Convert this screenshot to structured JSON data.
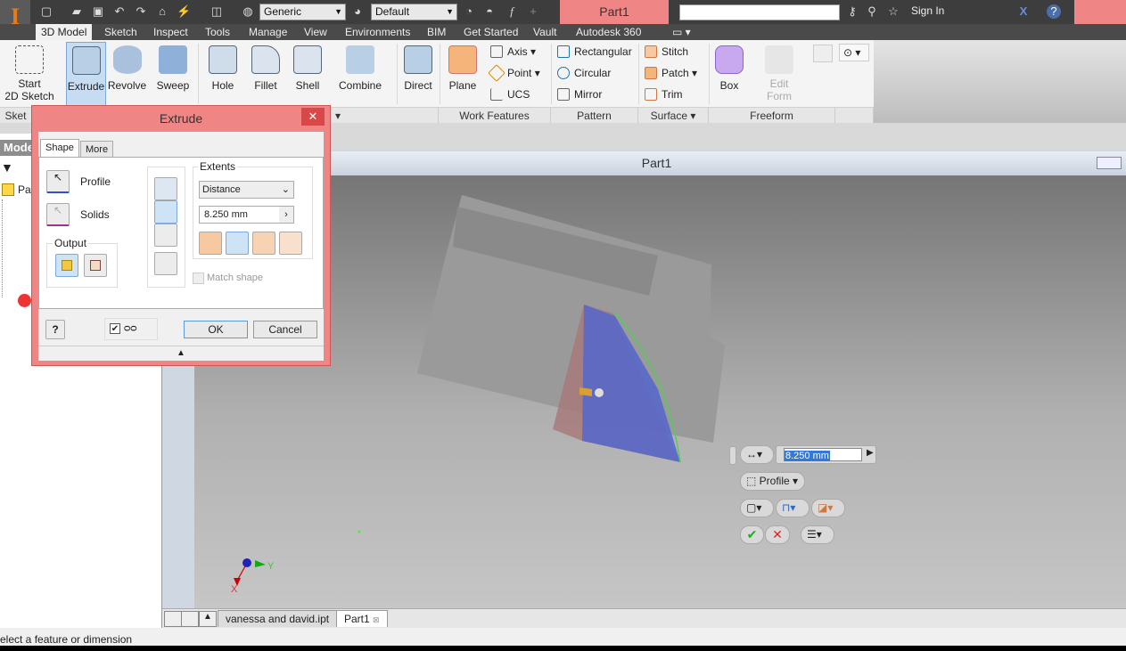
{
  "app": {
    "logo": "I",
    "document_title": "Part1",
    "material": "Generic",
    "appearance": "Default",
    "search_placeholder": "",
    "sign_in": "Sign In"
  },
  "ribbon_tabs": [
    "3D Model",
    "Sketch",
    "Inspect",
    "Tools",
    "Manage",
    "View",
    "Environments",
    "BIM",
    "Get Started",
    "Vault",
    "Autodesk 360"
  ],
  "active_tab": "3D Model",
  "ribbon": {
    "start_sketch": "Start\n2D Sketch",
    "extrude": "Extrude",
    "revolve": "Revolve",
    "sweep": "Sweep",
    "hole": "Hole",
    "fillet": "Fillet",
    "shell": "Shell",
    "combine": "Combine",
    "direct": "Direct",
    "plane": "Plane",
    "axis": "Axis",
    "point": "Point",
    "ucs": "UCS",
    "rectangular": "Rectangular",
    "circular": "Circular",
    "mirror": "Mirror",
    "stitch": "Stitch",
    "patch": "Patch",
    "trim": "Trim",
    "box": "Box",
    "edit_form": "Edit\nForm",
    "panels": {
      "sketch": "Sket",
      "work_features": "Work Features",
      "pattern": "Pattern",
      "surface": "Surface",
      "freeform": "Freeform"
    }
  },
  "browser": {
    "header": "Mode",
    "root": "Par"
  },
  "viewport": {
    "title": "Part1",
    "axes": {
      "x": "X",
      "y": "Y"
    }
  },
  "dialog": {
    "title": "Extrude",
    "tabs": [
      "Shape",
      "More"
    ],
    "profile": "Profile",
    "solids": "Solids",
    "output": "Output",
    "extents": "Extents",
    "extent_type": "Distance",
    "distance": "8.250 mm",
    "match_shape": "Match shape",
    "match_shape_checked": false,
    "preview_checked": true,
    "ok": "OK",
    "cancel": "Cancel"
  },
  "mini_toolbar": {
    "distance": "8.250 mm",
    "profile": "Profile"
  },
  "doc_tabs": [
    "vanessa and david.ipt",
    "Part1"
  ],
  "active_doc": "Part1",
  "status": "elect a feature or dimension",
  "colors": {
    "titlebar_accent": "#ef8585",
    "selected": "#c6dcf3",
    "profile_blue": "#4a55c8"
  }
}
